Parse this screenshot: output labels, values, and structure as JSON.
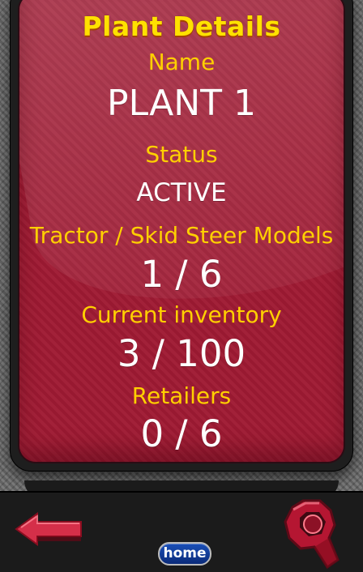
{
  "header": {
    "title": "Plant Details"
  },
  "details": {
    "name_label": "Name",
    "name_value": "PLANT 1",
    "status_label": "Status",
    "status_value": "ACTIVE",
    "models_label": "Tractor / Skid Steer Models",
    "models_value": "1 / 6",
    "inventory_label": "Current inventory",
    "inventory_value": "3 / 100",
    "retailers_label": "Retailers",
    "retailers_value": "0 / 6"
  },
  "footer": {
    "home_label": "home",
    "back_icon": "back-arrow-icon",
    "settings_icon": "settings-icon"
  },
  "colors": {
    "panel": "#9f1a33",
    "label": "#ffd000",
    "title": "#ffe100",
    "value": "#ffffff",
    "home_button": "#163f9a"
  }
}
